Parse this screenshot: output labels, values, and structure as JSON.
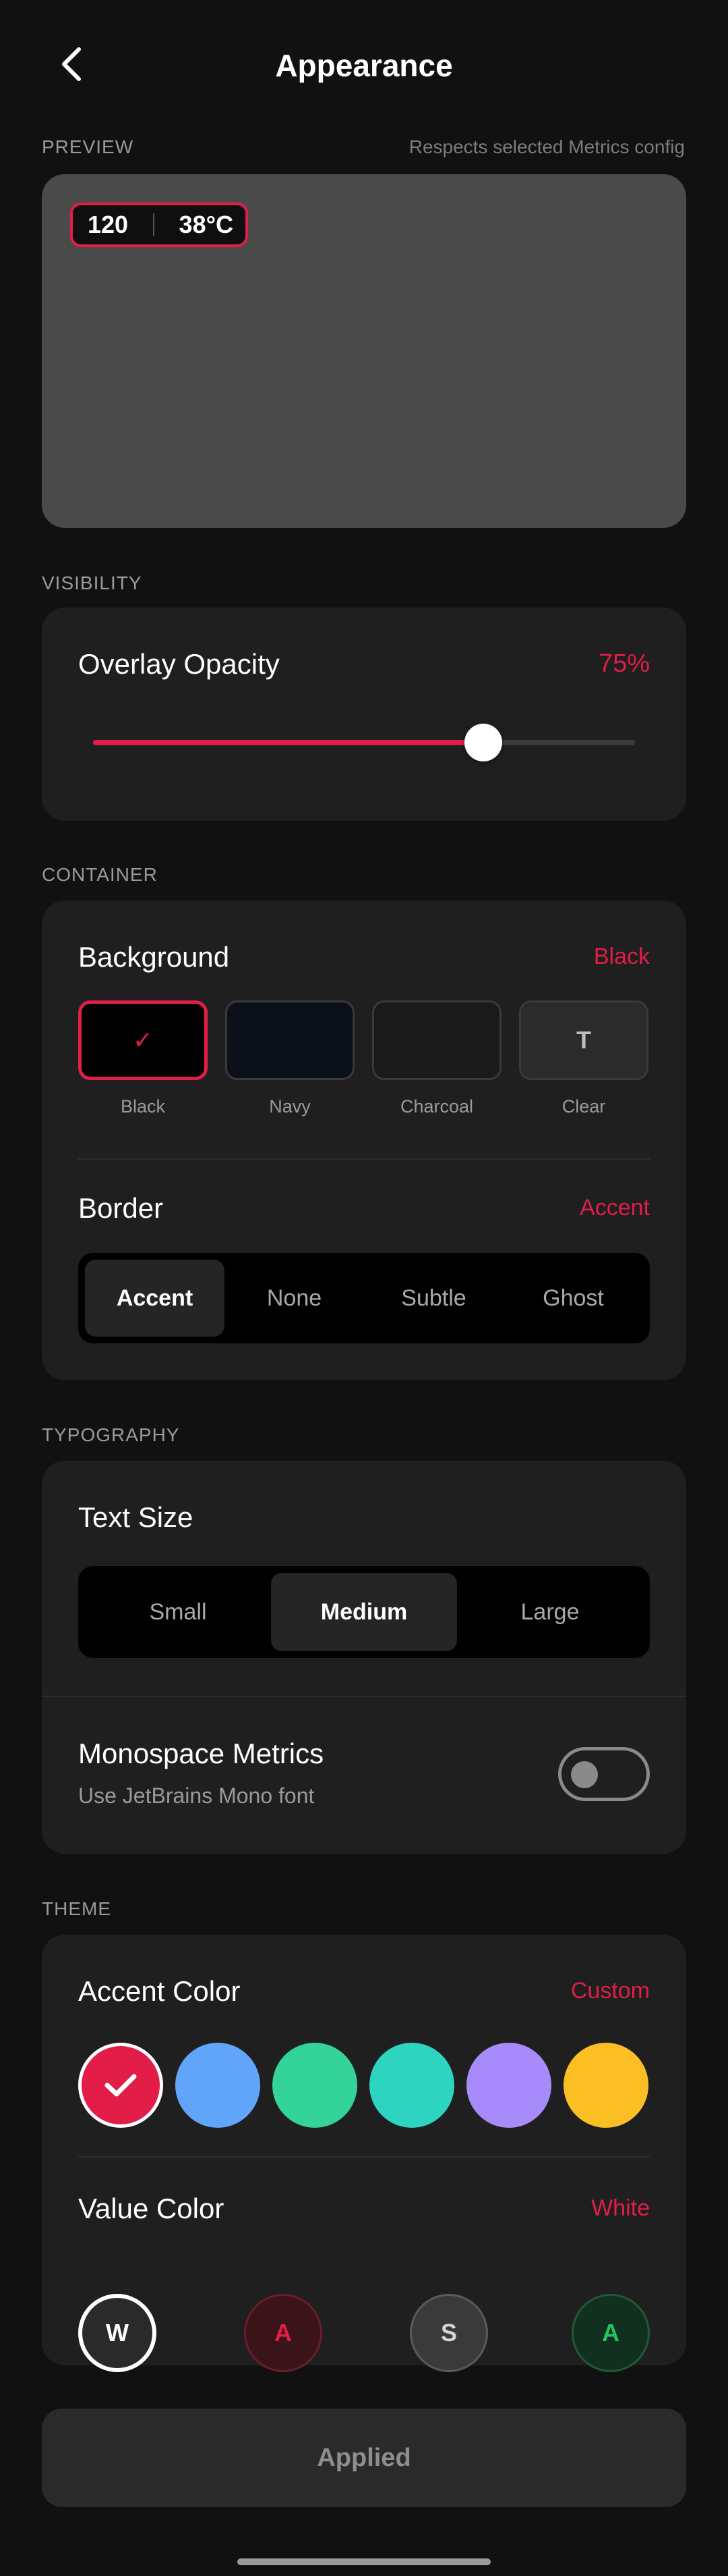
{
  "header": {
    "title": "Appearance"
  },
  "preview": {
    "label": "PREVIEW",
    "note": "Respects selected Metrics config",
    "metric_1": "120",
    "metric_2": "38°C"
  },
  "visibility": {
    "label": "VISIBILITY",
    "opacity_title": "Overlay Opacity",
    "opacity_value": "75%",
    "opacity_level": 0.72
  },
  "container": {
    "label": "CONTAINER",
    "background_title": "Background",
    "background_value": "Black",
    "backgrounds": [
      {
        "label": "Black",
        "color": "#000000",
        "glyph": "✓",
        "selected": true
      },
      {
        "label": "Navy",
        "color": "#0b101a",
        "glyph": "",
        "selected": false
      },
      {
        "label": "Charcoal",
        "color": "#1a1a1a",
        "glyph": "",
        "selected": false
      },
      {
        "label": "Clear",
        "color": "#2b2b2b",
        "glyph": "T",
        "selected": false
      }
    ],
    "border_title": "Border",
    "border_value": "Accent",
    "border_options": [
      "Accent",
      "None",
      "Subtle",
      "Ghost"
    ],
    "border_selected": 0
  },
  "typography": {
    "label": "TYPOGRAPHY",
    "text_size_title": "Text Size",
    "text_sizes": [
      "Small",
      "Medium",
      "Large"
    ],
    "text_size_selected": 1,
    "mono_title": "Monospace Metrics",
    "mono_subtitle": "Use JetBrains Mono font",
    "mono_enabled": false
  },
  "theme": {
    "label": "THEME",
    "accent_title": "Accent Color",
    "accent_value": "Custom",
    "accent_colors": [
      "#e11d48",
      "#60a5fa",
      "#34d399",
      "#2dd4bf",
      "#a78bfa",
      "#fbbf24"
    ],
    "accent_selected": 0,
    "value_title": "Value Color",
    "value_value": "White",
    "value_colors": [
      {
        "letter": "W",
        "fill": "#2a2a2a",
        "text": "#ffffff",
        "ring": "#ffffff"
      },
      {
        "letter": "A",
        "fill": "#3a1418",
        "text": "#e11d48",
        "ring": "#6b1d2a"
      },
      {
        "letter": "S",
        "fill": "#3a3a3a",
        "text": "#d4d4d4",
        "ring": "#5a5a5a"
      },
      {
        "letter": "A",
        "fill": "#12301f",
        "text": "#22c55e",
        "ring": "#1f5a36"
      }
    ]
  },
  "apply_button": "Applied",
  "colors": {
    "accent": "#e11d48",
    "background": "#111111",
    "card": "#1f1f1f"
  }
}
